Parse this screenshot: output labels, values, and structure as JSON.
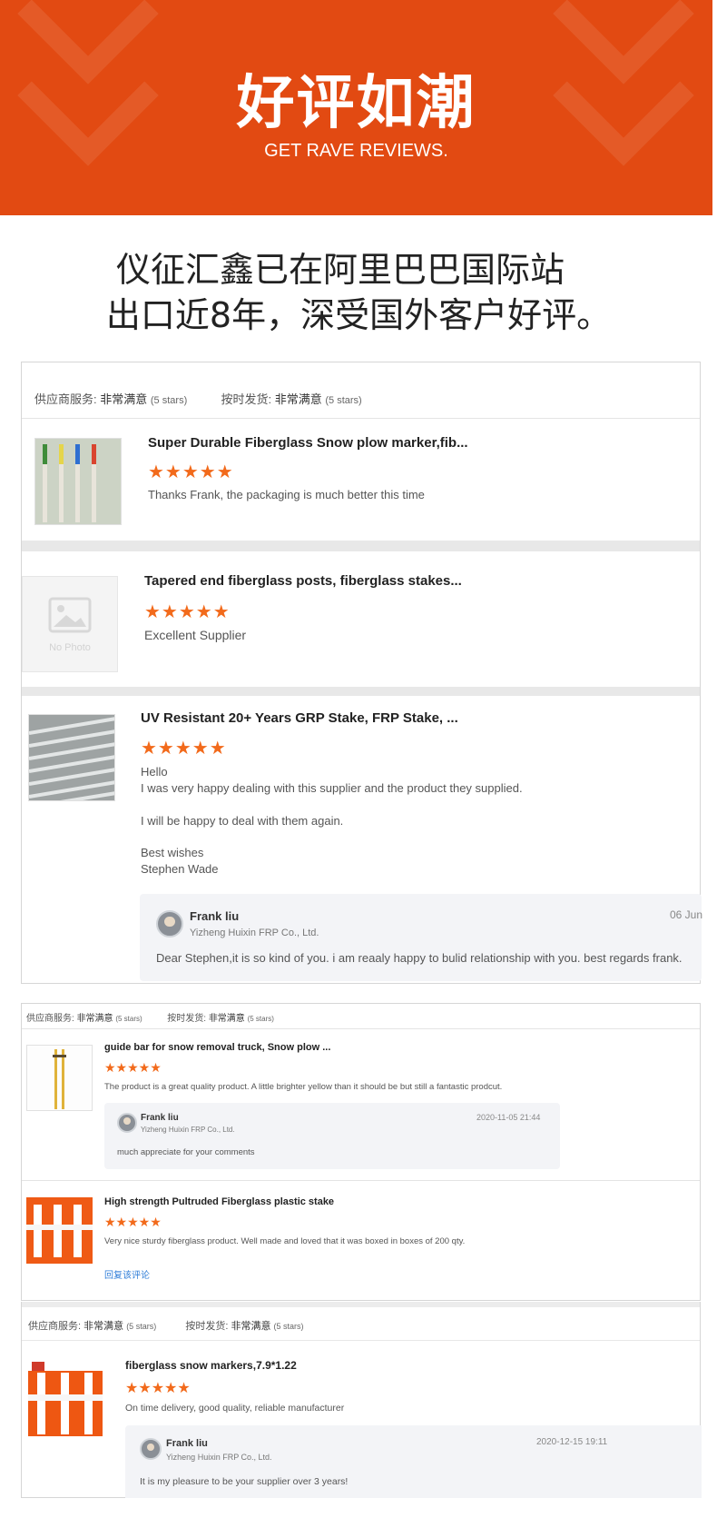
{
  "banner": {
    "title": "好评如潮",
    "subtitle": "GET RAVE REVIEWS.",
    "color": "#e24a12"
  },
  "headline": {
    "line1": "仪征汇鑫已在阿里巴巴国际站",
    "line2": "出口近8年，深受国外客户好评。"
  },
  "stars_glyph": "★★★★★",
  "panel1": {
    "header": {
      "service_label": "供应商服务:",
      "service_value": "非常满意",
      "service_stars": "(5 stars)",
      "delivery_label": "按时发货:",
      "delivery_value": "非常满意",
      "delivery_stars": "(5 stars)"
    },
    "reviews": [
      {
        "title": "Super Durable Fiberglass Snow plow marker,fib...",
        "text": "Thanks Frank, the packaging is much better this time"
      },
      {
        "title": "Tapered end fiberglass posts, fiberglass stakes...",
        "text": "Excellent Supplier",
        "no_photo": "No Photo"
      },
      {
        "title": "UV Resistant 20+ Years GRP Stake, FRP Stake, ...",
        "lines": [
          "Hello",
          "I was very happy dealing with this supplier and the product they supplied.",
          "I will be happy to deal with them again.",
          "Best wishes",
          "Stephen Wade"
        ],
        "reply": {
          "name": "Frank liu",
          "company": "Yizheng Huixin FRP Co., Ltd.",
          "date": "06 Jun",
          "text": "Dear Stephen,it is so kind of you. i am reaaly happy to bulid relationship with you. best regards frank."
        }
      }
    ]
  },
  "panel2": {
    "header": {
      "service_label": "供应商服务:",
      "service_value": "非常满意",
      "service_stars": "(5 stars)",
      "delivery_label": "按时发货:",
      "delivery_value": "非常满意",
      "delivery_stars": "(5 stars)"
    },
    "reviews": [
      {
        "title": "guide bar for snow removal truck, Snow plow ...",
        "text": "The product is a great quality product.  A little brighter yellow than it should be but still a fantastic prodcut.",
        "reply": {
          "name": "Frank liu",
          "company": "Yizheng Huixin FRP Co., Ltd.",
          "date": "2020-11-05 21:44",
          "text": "much appreciate for your comments"
        }
      },
      {
        "title": "High strength Pultruded Fiberglass plastic stake",
        "text": "Very nice sturdy fiberglass product.  Well made and loved that it was boxed in boxes of 200 qty.",
        "link": "回复该评论"
      }
    ]
  },
  "panel3": {
    "header": {
      "service_label": "供应商服务:",
      "service_value": "非常满意",
      "service_stars": "(5 stars)",
      "delivery_label": "按时发货:",
      "delivery_value": "非常满意",
      "delivery_stars": "(5 stars)"
    },
    "review": {
      "title": "fiberglass snow markers,7.9*1.22",
      "text": "On time delivery, good quality, reliable manufacturer",
      "reply": {
        "name": "Frank liu",
        "company": "Yizheng Huixin FRP Co., Ltd.",
        "date": "2020-12-15 19:11",
        "text": "It is my pleasure to be your supplier over 3 years!"
      }
    }
  }
}
